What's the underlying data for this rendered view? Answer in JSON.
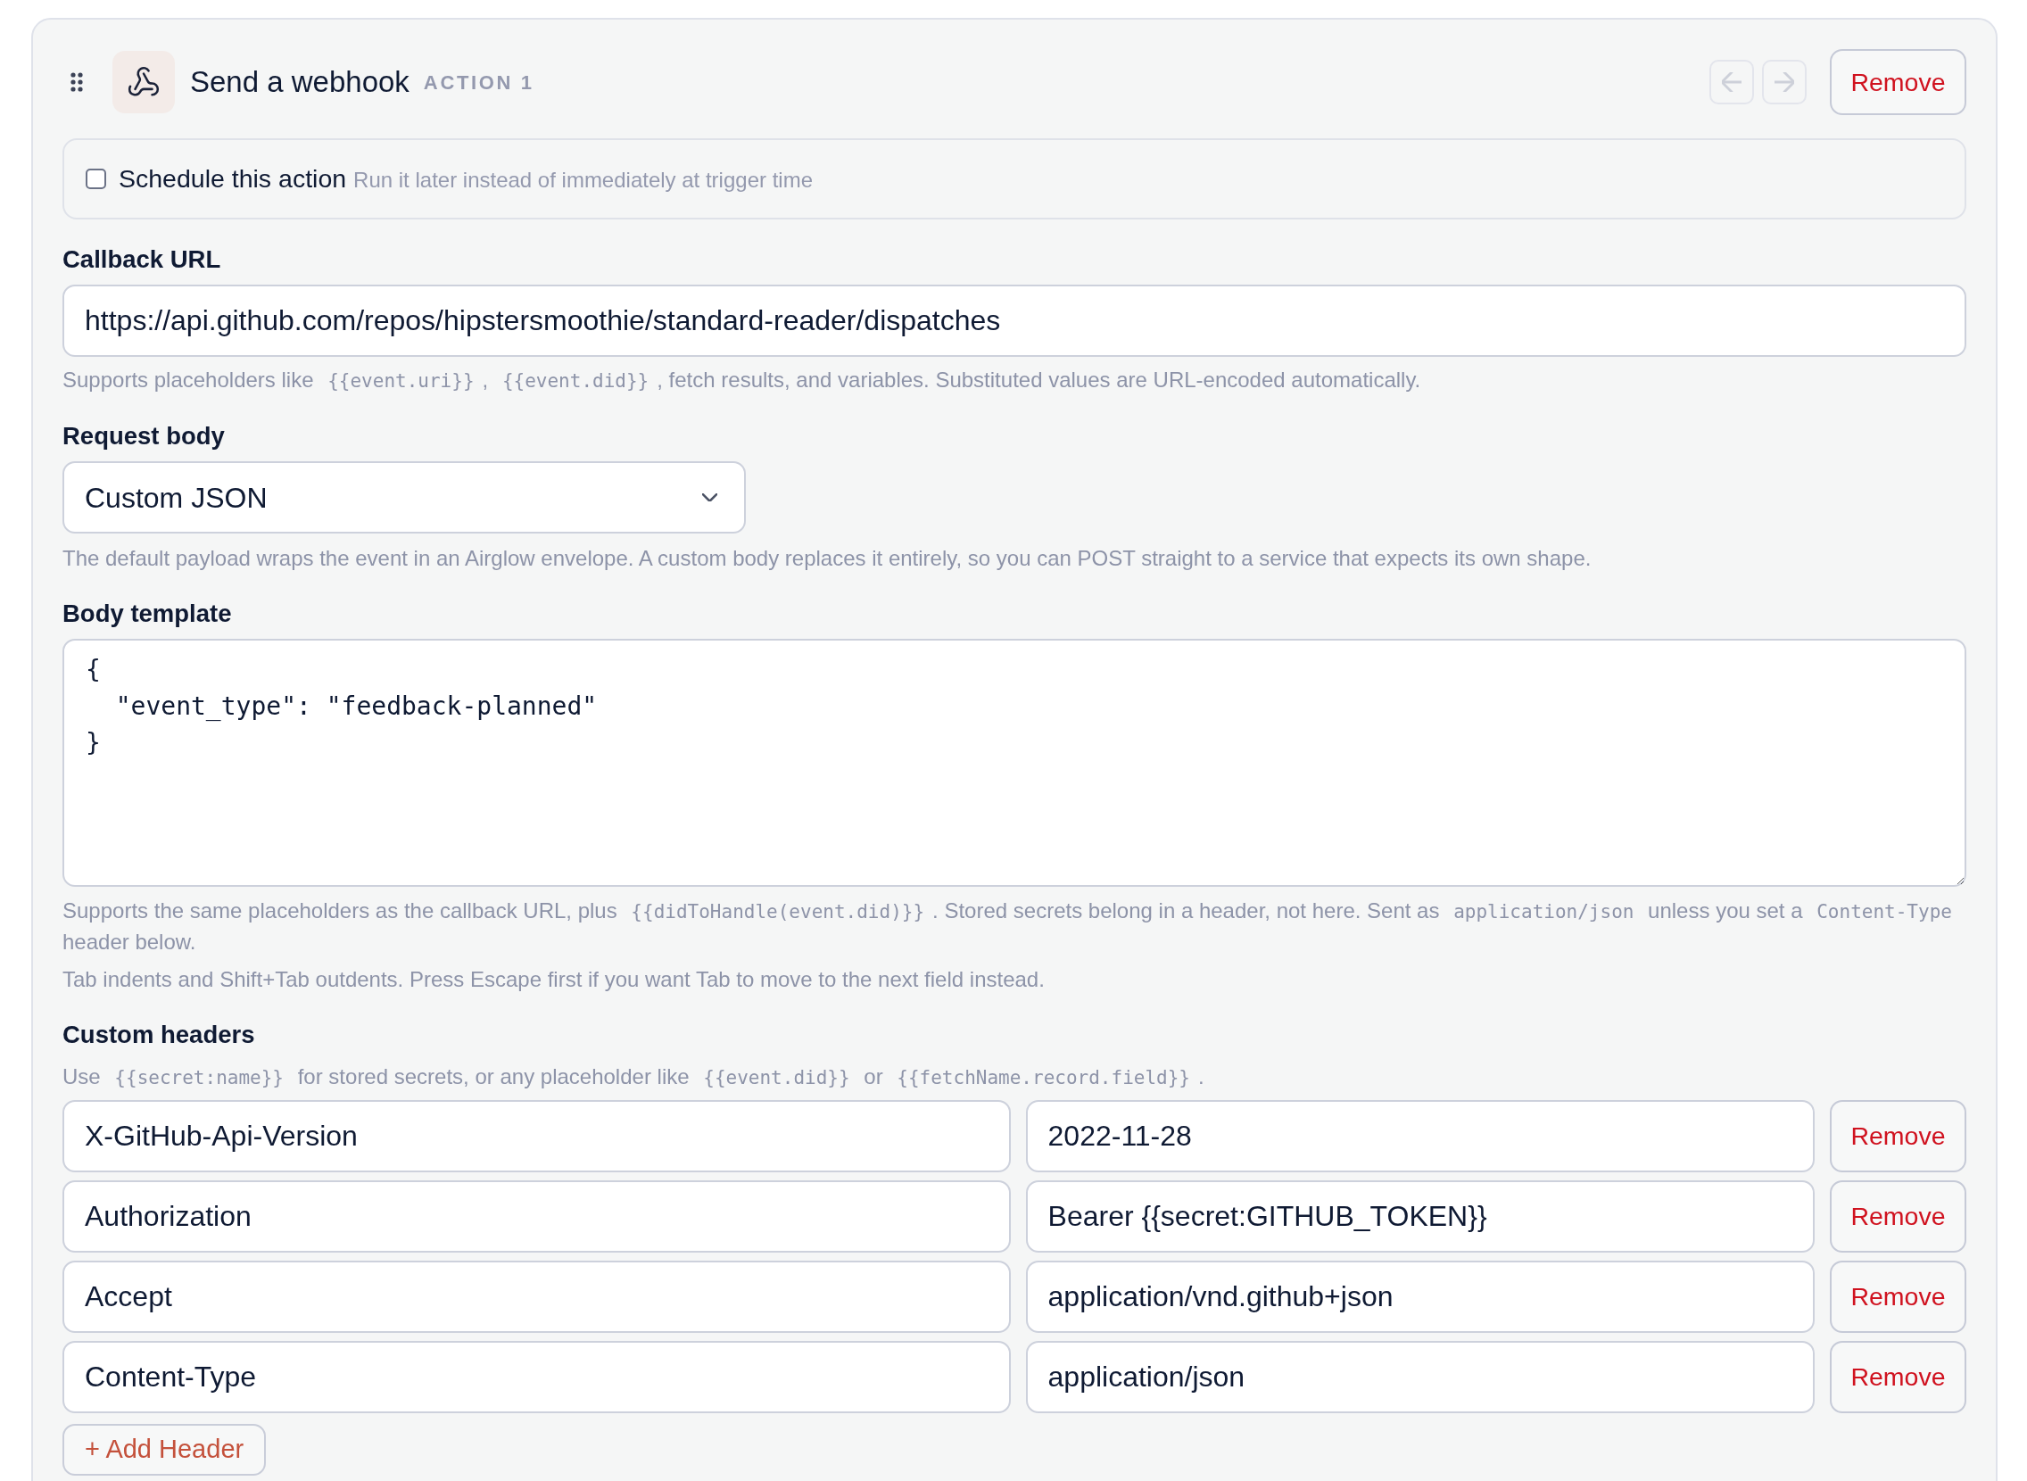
{
  "action": {
    "title": "Send a webhook",
    "badge": "ACTION 1",
    "move_left": {
      "disabled": true
    },
    "move_right": {
      "disabled": true
    },
    "remove": "Remove"
  },
  "schedule": {
    "checked": false,
    "label": "Schedule this action",
    "hint": "Run it later instead of immediately at trigger time"
  },
  "callback_url": {
    "label": "Callback URL",
    "value": "https://api.github.com/repos/hipstersmoothie/standard-reader/dispatches",
    "help": [
      {
        "kind": "text",
        "text": "Supports placeholders like "
      },
      {
        "kind": "code",
        "text": "{{event.uri}}"
      },
      {
        "kind": "text",
        "text": ", "
      },
      {
        "kind": "code",
        "text": "{{event.did}}"
      },
      {
        "kind": "text",
        "text": ", fetch results, and variables. Substituted values are URL-encoded automatically."
      }
    ]
  },
  "request_body": {
    "label": "Request body",
    "value": "Custom JSON",
    "help": [
      {
        "kind": "text",
        "text": "The default payload wraps the event in an Airglow envelope. A custom body replaces it entirely, so you can POST straight to a service that expects its own shape."
      }
    ]
  },
  "body_template": {
    "label": "Body template",
    "value": "{\n  \"event_type\": \"feedback-planned\"\n}",
    "help": [
      {
        "kind": "text",
        "text": "Supports the same placeholders as the callback URL, plus "
      },
      {
        "kind": "code",
        "text": "{{didToHandle(event.did)}}"
      },
      {
        "kind": "text",
        "text": ". Stored secrets belong in a header, not here. Sent as "
      },
      {
        "kind": "code",
        "text": "application/json"
      },
      {
        "kind": "text",
        "text": " unless you set a "
      },
      {
        "kind": "code",
        "text": "Content-Type"
      },
      {
        "kind": "text",
        "text": " header below."
      }
    ],
    "note": "Tab indents and Shift+Tab outdents. Press Escape first if you want Tab to move to the next field instead."
  },
  "custom_headers": {
    "label": "Custom headers",
    "help": [
      {
        "kind": "text",
        "text": "Use "
      },
      {
        "kind": "code",
        "text": "{{secret:name}}"
      },
      {
        "kind": "text",
        "text": " for stored secrets, or any placeholder like "
      },
      {
        "kind": "code",
        "text": "{{event.did}}"
      },
      {
        "kind": "text",
        "text": " or "
      },
      {
        "kind": "code",
        "text": "{{fetchName.record.field}}"
      },
      {
        "kind": "text",
        "text": "."
      }
    ],
    "rows": [
      {
        "name": "X-GitHub-Api-Version",
        "value": "2022-11-28",
        "remove": "Remove"
      },
      {
        "name": "Authorization",
        "value": "Bearer {{secret:GITHUB_TOKEN}}",
        "remove": "Remove"
      },
      {
        "name": "Accept",
        "value": "application/vnd.github+json",
        "remove": "Remove"
      },
      {
        "name": "Content-Type",
        "value": "application/json",
        "remove": "Remove"
      }
    ],
    "add": "+ Add Header"
  }
}
